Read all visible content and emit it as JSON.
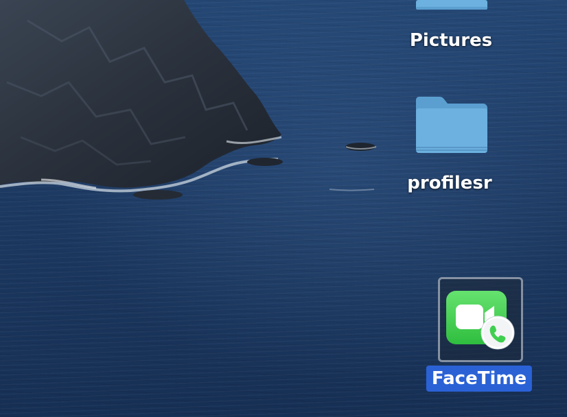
{
  "desktop": {
    "icons": [
      {
        "label": "Pictures",
        "type": "folder-icon",
        "selected": false
      },
      {
        "label": "profilesr",
        "type": "folder-icon",
        "selected": false
      },
      {
        "label": "FaceTime",
        "type": "facetime-app-icon",
        "selected": true
      }
    ]
  },
  "colors": {
    "selection_label": "#2a62d6",
    "folder": "#6cb1e0",
    "facetime_green": "#3fcf4f"
  }
}
